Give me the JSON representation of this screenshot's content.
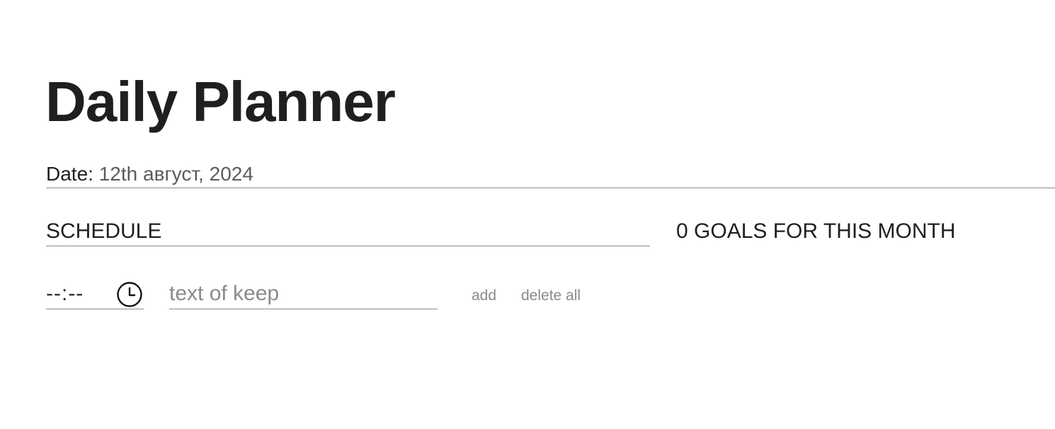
{
  "header": {
    "title": "Daily Planner"
  },
  "date": {
    "label": "Date:",
    "value": "12th август, 2024"
  },
  "schedule": {
    "heading": "SCHEDULE",
    "time_value": "--:--",
    "time_icon": "clock-icon",
    "keep_placeholder": "text of keep",
    "add_label": "add",
    "delete_all_label": "delete all"
  },
  "goals": {
    "heading": "0 GOALS FOR THIS MONTH"
  },
  "colors": {
    "text": "#1f1f1f",
    "muted": "#8a8a8a",
    "date_value": "#5c5c5c",
    "rule": "#8a8a8a",
    "background": "#ffffff"
  }
}
